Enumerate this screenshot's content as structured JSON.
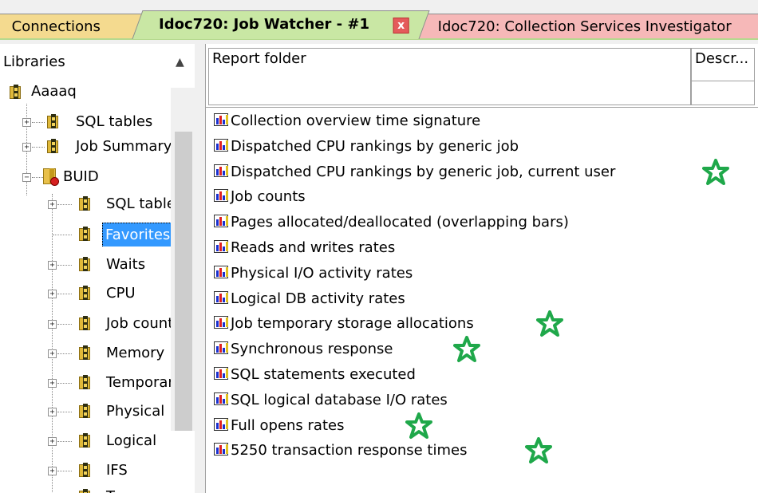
{
  "tabs": {
    "connections": "Connections",
    "job_watcher": "Idoc720:  Job Watcher - #1",
    "job_watcher_close": "x",
    "collection": "Idoc720:  Collection Services Investigator"
  },
  "tree": {
    "header": "Libraries",
    "items": [
      {
        "label": "Aaaaq",
        "icon": "folder-icon"
      },
      {
        "label": "SQL tables",
        "icon": "folder-icon"
      },
      {
        "label": "Job Summary",
        "icon": "folder-icon"
      },
      {
        "label": "BUID",
        "icon": "library-icon"
      },
      {
        "label": "SQL tables",
        "icon": "folder-icon"
      },
      {
        "label": "Favorites",
        "icon": "folder-icon",
        "selected": true
      },
      {
        "label": "Waits",
        "icon": "folder-icon"
      },
      {
        "label": "CPU",
        "icon": "folder-icon"
      },
      {
        "label": "Job counts",
        "icon": "folder-icon"
      },
      {
        "label": "Memory",
        "icon": "folder-icon"
      },
      {
        "label": "Temporary",
        "icon": "folder-icon"
      },
      {
        "label": "Physical",
        "icon": "folder-icon"
      },
      {
        "label": "Logical",
        "icon": "folder-icon"
      },
      {
        "label": "IFS",
        "icon": "folder-icon"
      },
      {
        "label": "Top consumers",
        "icon": "folder-icon"
      }
    ]
  },
  "list": {
    "columns": [
      "Report folder",
      "Descr..."
    ],
    "rows": [
      {
        "label": "Collection overview time signature",
        "starred": false
      },
      {
        "label": "Dispatched CPU rankings by generic job",
        "starred": false
      },
      {
        "label": "Dispatched CPU rankings by generic job, current user",
        "starred": true
      },
      {
        "label": "Job counts",
        "starred": false
      },
      {
        "label": "Pages allocated/deallocated (overlapping bars)",
        "starred": false
      },
      {
        "label": "Reads and writes rates",
        "starred": false
      },
      {
        "label": "Physical I/O activity rates",
        "starred": false
      },
      {
        "label": "Logical DB activity rates",
        "starred": false
      },
      {
        "label": "Job temporary storage allocations",
        "starred": true
      },
      {
        "label": "Synchronous response",
        "starred": true
      },
      {
        "label": "SQL statements executed",
        "starred": false
      },
      {
        "label": "SQL logical database I/O rates",
        "starred": false
      },
      {
        "label": "Full opens rates",
        "starred": true
      },
      {
        "label": "5250 transaction response times",
        "starred": true
      }
    ]
  },
  "colors": {
    "star": "#1fa84a",
    "selection": "#3399ff",
    "tab_active": "#c9e7a4",
    "tab_connections": "#f4da8f",
    "tab_collection": "#f6b8b8"
  }
}
